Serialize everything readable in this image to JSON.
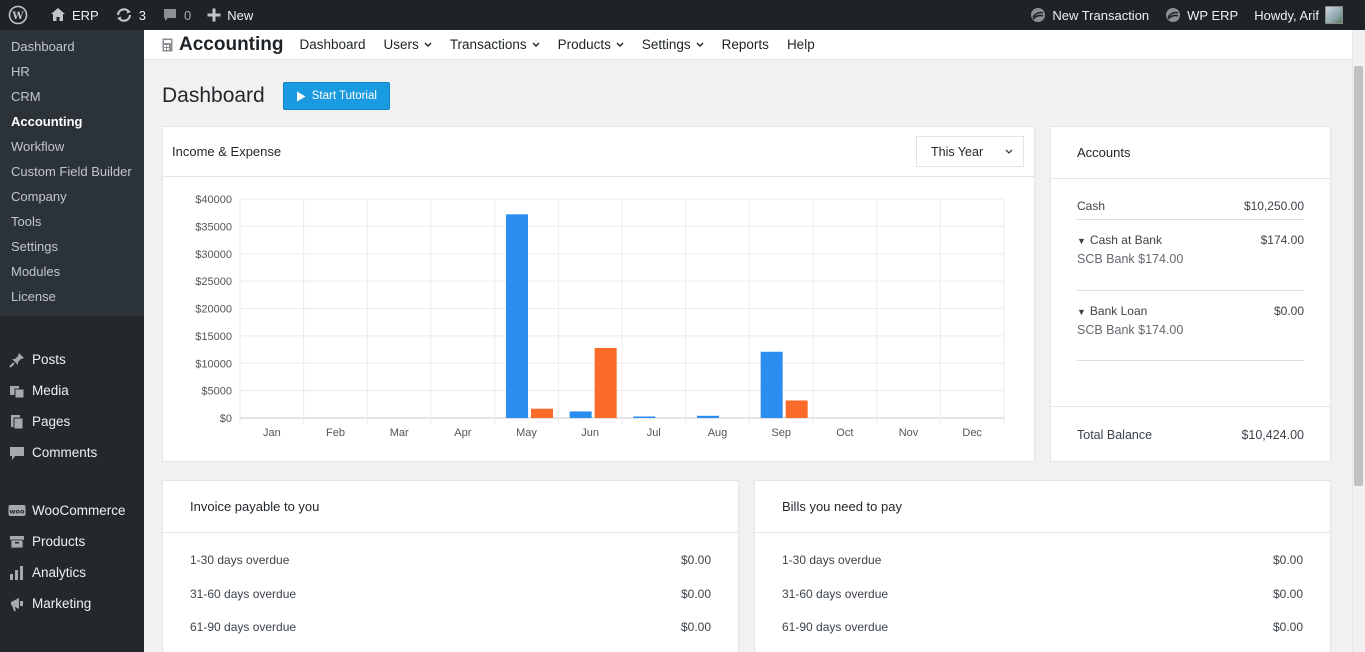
{
  "adminbar": {
    "site_name": "ERP",
    "updates_count": "3",
    "comments_count": "0",
    "new_label": "New",
    "new_transaction": "New Transaction",
    "wp_erp": "WP ERP",
    "howdy": "Howdy, Arif"
  },
  "sidebar": {
    "submenu": [
      "Dashboard",
      "HR",
      "CRM",
      "Accounting",
      "Workflow",
      "Custom Field Builder",
      "Company",
      "Tools",
      "Settings",
      "Modules",
      "License"
    ],
    "menu": [
      "Posts",
      "Media",
      "Pages",
      "Comments",
      "WooCommerce",
      "Products",
      "Analytics",
      "Marketing"
    ]
  },
  "topnav": {
    "brand": "Accounting",
    "links": [
      "Dashboard",
      "Users",
      "Transactions",
      "Products",
      "Settings",
      "Reports",
      "Help"
    ]
  },
  "page": {
    "title": "Dashboard",
    "tutorial_button": "Start Tutorial"
  },
  "income": {
    "title": "Income & Expense",
    "period": "This Year"
  },
  "chart_data": {
    "type": "bar",
    "categories": [
      "Jan",
      "Feb",
      "Mar",
      "Apr",
      "May",
      "Jun",
      "Jul",
      "Aug",
      "Sep",
      "Oct",
      "Nov",
      "Dec"
    ],
    "series": [
      {
        "color": "#2a8ef0",
        "values": [
          0,
          0,
          0,
          0,
          37200,
          1200,
          100,
          400,
          12100,
          0,
          0,
          0
        ]
      },
      {
        "color": "#fb6b2a",
        "values": [
          0,
          0,
          0,
          0,
          1700,
          12800,
          0,
          0,
          3200,
          0,
          0,
          0
        ]
      }
    ],
    "yticks": [
      "$0",
      "$5000",
      "$10000",
      "$15000",
      "$20000",
      "$25000",
      "$30000",
      "$35000",
      "$40000"
    ],
    "ylim": [
      0,
      40000
    ],
    "grid": true
  },
  "accounts": {
    "title": "Accounts",
    "cash_label": "Cash",
    "cash_value": "$10,250.00",
    "bank_label": "Cash at Bank",
    "bank_value": "$174.00",
    "bank_sub": "SCB Bank $174.00",
    "loan_label": "Bank Loan",
    "loan_value": "$0.00",
    "loan_sub": "SCB Bank $174.00",
    "total_label": "Total Balance",
    "total_value": "$10,424.00"
  },
  "invoice": {
    "title": "Invoice payable to you",
    "rows": [
      {
        "label": "1-30 days overdue",
        "value": "$0.00"
      },
      {
        "label": "31-60 days overdue",
        "value": "$0.00"
      },
      {
        "label": "61-90 days overdue",
        "value": "$0.00"
      }
    ]
  },
  "bills": {
    "title": "Bills you need to pay",
    "rows": [
      {
        "label": "1-30 days overdue",
        "value": "$0.00"
      },
      {
        "label": "31-60 days overdue",
        "value": "$0.00"
      },
      {
        "label": "61-90 days overdue",
        "value": "$0.00"
      }
    ]
  }
}
